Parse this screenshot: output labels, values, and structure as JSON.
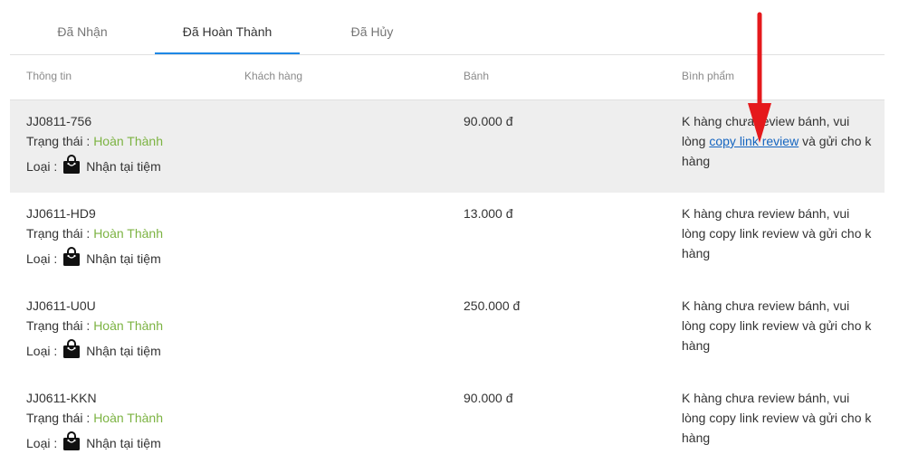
{
  "tabs": [
    {
      "label": "Đã Nhận"
    },
    {
      "label": "Đã Hoàn Thành"
    },
    {
      "label": "Đã Hủy"
    }
  ],
  "columns": {
    "info": "Thông tin",
    "customer": "Khách hàng",
    "cake": "Bánh",
    "review": "Bình phẩm"
  },
  "labels": {
    "status_prefix": "Trạng thái :",
    "type_prefix": "Loại :",
    "pickup": "Nhận tại tiệm",
    "review_before": "K hàng chưa review bánh, vui lòng",
    "review_link": "copy link review",
    "review_after": "và gửi cho k hàng"
  },
  "icons": {
    "bag": "shopping-bag-icon",
    "arrow": "red-arrow-down"
  },
  "colors": {
    "accent": "#1e88e5",
    "status": "#7cb342",
    "link": "#1565c0",
    "arrow": "#e5191c",
    "highlight_row": "#eeeeee"
  },
  "orders": [
    {
      "code": "JJ0811-756",
      "status": "Hoàn Thành",
      "price": "90.000 đ"
    },
    {
      "code": "JJ0611-HD9",
      "status": "Hoàn Thành",
      "price": "13.000 đ"
    },
    {
      "code": "JJ0611-U0U",
      "status": "Hoàn Thành",
      "price": "250.000 đ"
    },
    {
      "code": "JJ0611-KKN",
      "status": "Hoàn Thành",
      "price": "90.000 đ"
    }
  ]
}
